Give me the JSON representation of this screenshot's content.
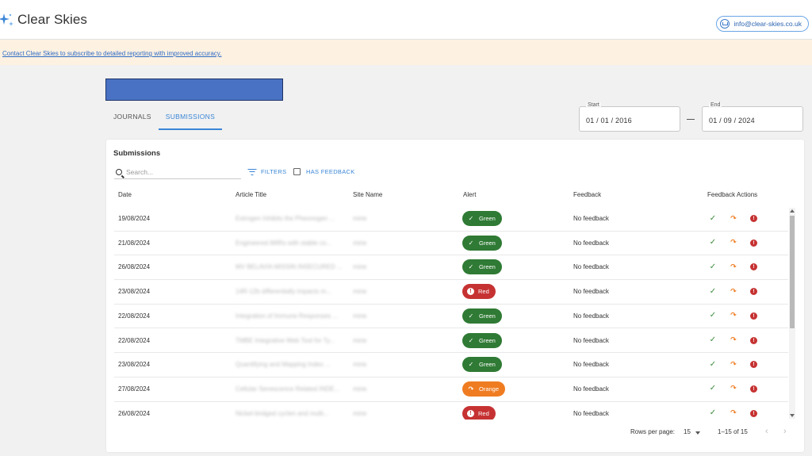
{
  "app": {
    "name": "Clear Skies",
    "contact_email": "info@clear-skies.co.uk"
  },
  "banner": {
    "link_text": "Contact Clear Skies to subscribe to detailed reporting with improved accuracy."
  },
  "tabs": [
    {
      "label": "JOURNALS",
      "active": false
    },
    {
      "label": "SUBMISSIONS",
      "active": true
    }
  ],
  "dates": {
    "start_label": "Start",
    "start_value": "01 / 01 / 2016",
    "end_label": "End",
    "end_value": "01 / 09 / 2024"
  },
  "panel": {
    "title": "Submissions",
    "search_placeholder": "Search...",
    "filters_label": "FILTERS",
    "has_feedback_label": "HAS FEEDBACK"
  },
  "columns": [
    "Date",
    "Article Title",
    "Site Name",
    "Alert",
    "Feedback",
    "Feedback Actions"
  ],
  "rows": [
    {
      "date": "19/08/2024",
      "title": "Estrogen Inhibits the Pheonogen ...",
      "site": "mine",
      "alert": "Green",
      "feedback": "No feedback"
    },
    {
      "date": "21/08/2024",
      "title": "Engineered iMIRs with stable co...",
      "site": "mine",
      "alert": "Green",
      "feedback": "No feedback"
    },
    {
      "date": "26/08/2024",
      "title": "MV BELAVIA MISSIN INSECURED ...",
      "site": "mine",
      "alert": "Green",
      "feedback": "No feedback"
    },
    {
      "date": "23/08/2024",
      "title": "14R-12b differentially impacts m...",
      "site": "mine",
      "alert": "Red",
      "feedback": "No feedback"
    },
    {
      "date": "22/08/2024",
      "title": "Integration of Immune Responses ...",
      "site": "mine",
      "alert": "Green",
      "feedback": "No feedback"
    },
    {
      "date": "22/08/2024",
      "title": "TMBE Integrative Web Tool for Ty...",
      "site": "mine",
      "alert": "Green",
      "feedback": "No feedback"
    },
    {
      "date": "23/08/2024",
      "title": "Quantifying and Mapping Index ...",
      "site": "mine",
      "alert": "Green",
      "feedback": "No feedback"
    },
    {
      "date": "27/08/2024",
      "title": "Cellular Senescence Related INDE...",
      "site": "mine",
      "alert": "Orange",
      "feedback": "No feedback"
    },
    {
      "date": "26/08/2024",
      "title": "Nickel-bridged cyclen and multi...",
      "site": "mine",
      "alert": "Red",
      "feedback": "No feedback"
    }
  ],
  "pagination": {
    "rows_per_page_label": "Rows per page:",
    "rows_per_page_value": "15",
    "range_text": "1–15 of 15"
  },
  "colors": {
    "accent": "#3a86d6",
    "green": "#2f7a34",
    "red": "#c63232",
    "orange": "#ef7c21",
    "banner": "#fdf1e2",
    "title_block": "#4a72c4"
  },
  "icons": {
    "logo": "sparkle-icon",
    "contact": "mail-icon",
    "search": "search-icon",
    "filters": "filter-icon",
    "ok": "check-icon",
    "redirect": "redirect-arrow-icon",
    "flag": "alert-circle-icon"
  }
}
